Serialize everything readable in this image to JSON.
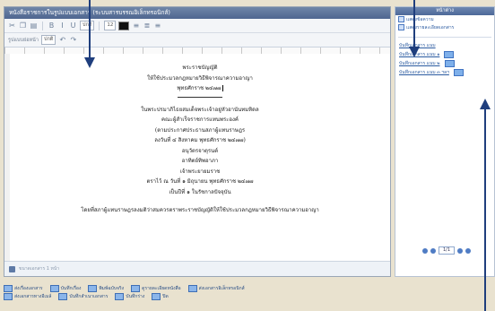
{
  "window": {
    "title": "หนังสือราชการในรูปแบบเอกสาร (ระบบสารบรรณอิเล็กทรอนิกส์)"
  },
  "toolbar": {
    "font_size": "12",
    "style_select": "ปกติ",
    "paragraph_label": "รูปแบบย่อหน้า",
    "paragraph_value": "ปกติ"
  },
  "document": {
    "lines": [
      "พระราชบัญญัติ",
      "ให้ใช้ประมวลกฎหมายวิธีพิจารณาความอาญา",
      "พุทธศักราช ๒๔๗๗"
    ],
    "body": [
      "ในพระปรมาภิไธยสมเด็จพระเจ้าอยู่หัวอานันทมหิดล",
      "คณะผู้สำเร็จราชการแทนพระองค์",
      "(ตามประกาศประธานสภาผู้แทนราษฎร",
      "ลงวันที่ ๔ สิงหาคม พุทธศักราช ๒๔๗๗)",
      "อนุวัตรจาตุรนต์",
      "อาทิตย์ทิพอาภา",
      "เจ้าพระยายมราช",
      "ตราไว้ ณ วันที่ ๑ มิถุนายน พุทธศักราช ๒๔๗๗",
      "เป็นปีที่ ๑ ในรัชกาลปัจจุบัน"
    ],
    "closing": "โดยที่สภาผู้แทนราษฎรลงมติว่าสมควรตราพระราชบัญญัติให้ใช้ประมวลกฎหมายวิธีพิจารณาความอาญา"
  },
  "status": {
    "text": "ขนาดเอกสาร 1 หน้า"
  },
  "panel": {
    "heading": "หน้าต่าง",
    "options": [
      "แสดงข้อความ",
      "แสดงรายละเอียดเอกสาร"
    ],
    "links": [
      "บันทึกเอกสาร แนบ",
      "บันทึกเอกสาร แนบ ๑",
      "บันทึกเอกสาร แนบ ๒",
      "บันทึกเอกสาร แนบ ๓ ฯลฯ"
    ],
    "pager": "1/1"
  },
  "legend": {
    "row1": [
      "ส่งเรื่องเอกสาร",
      "บันทึกเรื่อง",
      "พิมพ์ฉบับจริง",
      "ดูรายละเอียดหนังสือ",
      "ส่งเอกสารอิเล็กทรอนิกส์"
    ],
    "row2": [
      "ส่งเอกสารทางอีเมล์",
      "บันทึกสำเนาเอกสาร",
      "บันทึกร่าง",
      "ปิด"
    ]
  },
  "colors": {
    "accent": "#2a5aa0",
    "arrow": "#1f3e7d"
  }
}
